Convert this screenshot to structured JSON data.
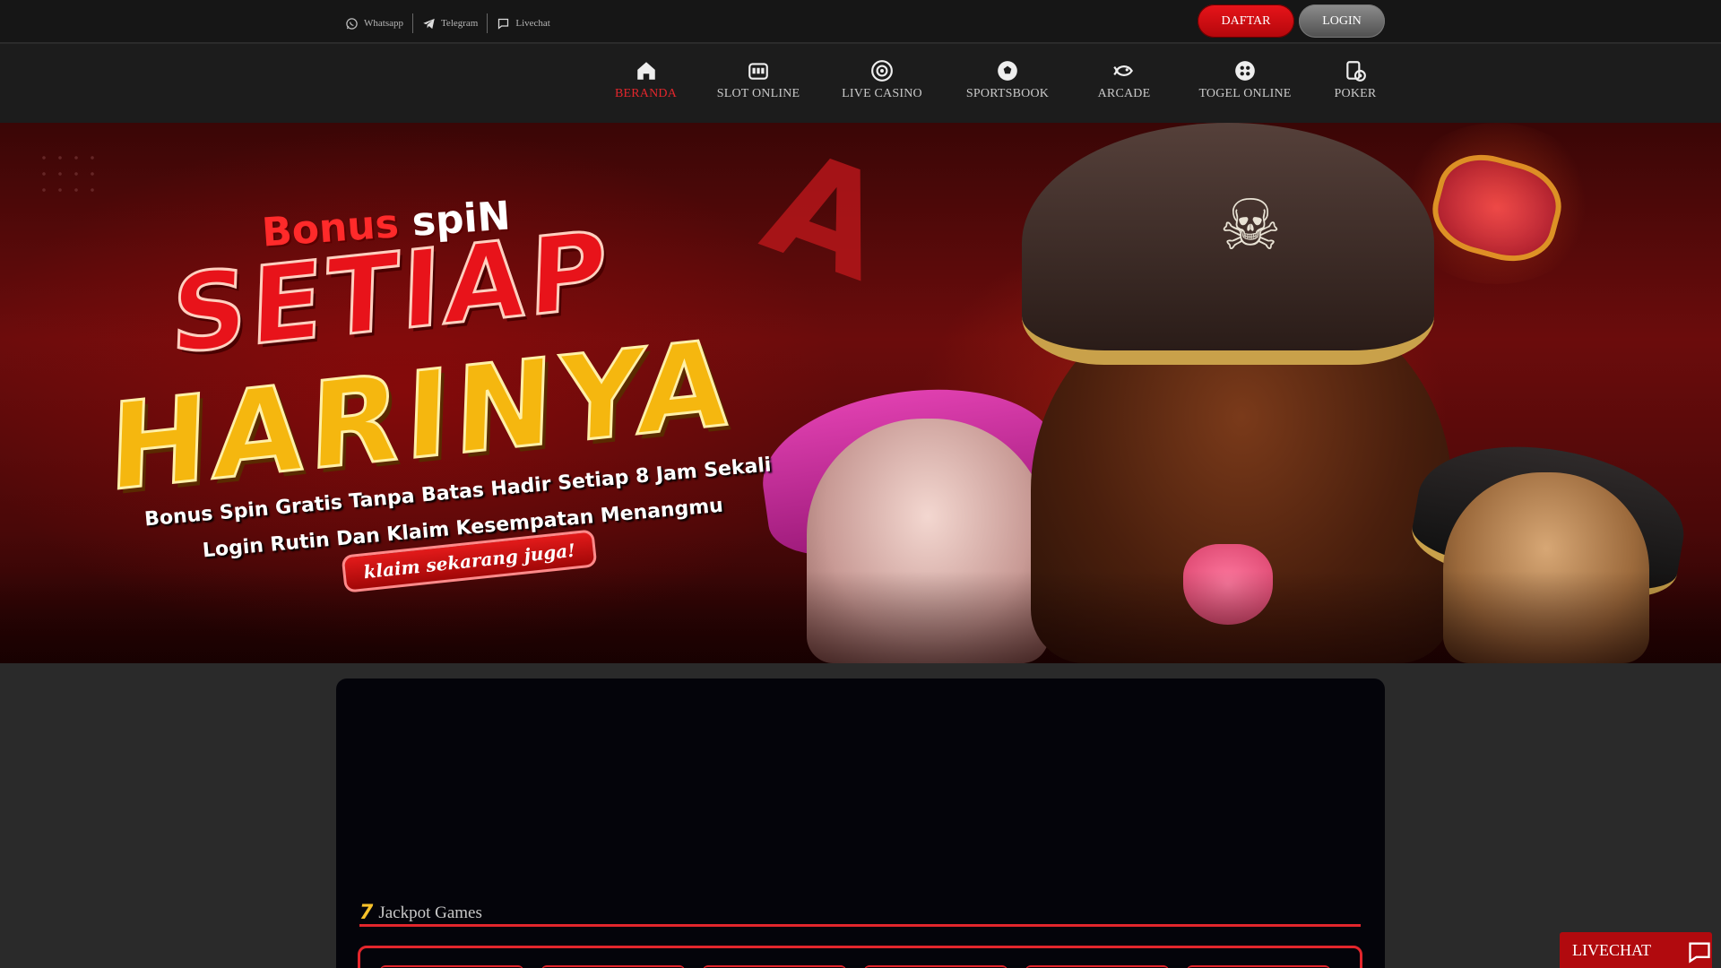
{
  "topbar": {
    "contacts": [
      {
        "label": "Whatsapp",
        "icon": "whatsapp-icon"
      },
      {
        "label": "Telegram",
        "icon": "telegram-icon"
      },
      {
        "label": "Livechat",
        "icon": "chat-icon"
      }
    ],
    "daftar_label": "DAFTAR",
    "login_label": "LOGIN"
  },
  "nav": {
    "items": [
      {
        "label": "BERANDA",
        "icon": "home-icon",
        "active": true
      },
      {
        "label": "SLOT ONLINE",
        "icon": "slot-machine-icon"
      },
      {
        "label": "LIVE CASINO",
        "icon": "roulette-icon"
      },
      {
        "label": "SPORTSBOOK",
        "icon": "soccer-ball-icon"
      },
      {
        "label": "ARCADE",
        "icon": "fish-icon"
      },
      {
        "label": "TOGEL ONLINE",
        "icon": "lottery-balls-icon"
      },
      {
        "label": "POKER",
        "icon": "poker-cards-icon"
      }
    ]
  },
  "banner": {
    "bonus_word1": "Bonus",
    "bonus_word2": "spiN",
    "headline1": "SETIAP",
    "headline2": "HARINYA",
    "subtext1": "Bonus Spin Gratis Tanpa Batas Hadir Setiap 8 Jam Sekali",
    "subtext2": "Login Rutin Dan Klaim Kesempatan Menangmu",
    "cta": "klaim sekarang juga!"
  },
  "jackpot": {
    "icon_text": "7",
    "title": "Jackpot Games"
  },
  "livechat": {
    "label": "LIVECHAT"
  },
  "colors": {
    "accent": "#e3262c",
    "topbar_bg": "#161616",
    "nav_bg": "#1c1c1c",
    "page_bg": "#2a2a2a",
    "panel_bg": "#04040a"
  }
}
